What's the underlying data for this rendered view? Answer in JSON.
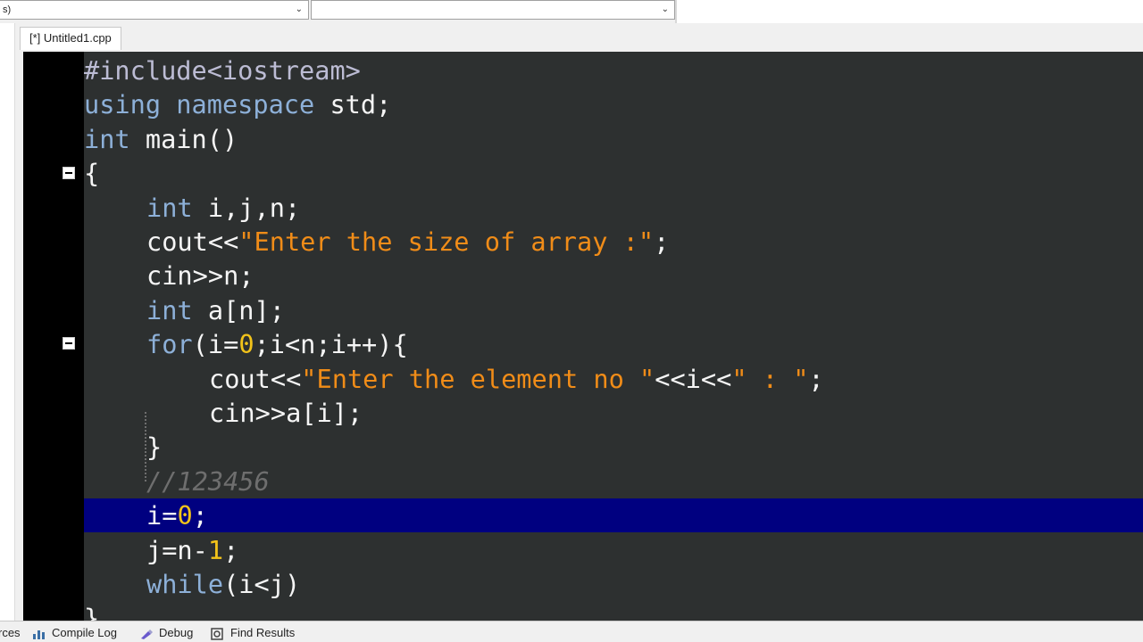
{
  "toolbar": {
    "combo1_value": "s)",
    "combo2_value": ""
  },
  "tabs": [
    {
      "label": "[*] Untitled1.cpp"
    }
  ],
  "editor": {
    "lines": [
      {
        "tokens": [
          {
            "t": "#include<iostream>",
            "c": "pre"
          }
        ]
      },
      {
        "tokens": [
          {
            "t": "using ",
            "c": "kw"
          },
          {
            "t": "namespace ",
            "c": "kw"
          },
          {
            "t": "std;",
            "c": "txt"
          }
        ]
      },
      {
        "tokens": [
          {
            "t": "int ",
            "c": "kw"
          },
          {
            "t": "main()",
            "c": "txt"
          }
        ]
      },
      {
        "tokens": [
          {
            "t": "{",
            "c": "txt"
          }
        ]
      },
      {
        "tokens": [
          {
            "t": "int ",
            "c": "kw"
          },
          {
            "t": "i,j,n;",
            "c": "txt"
          }
        ]
      },
      {
        "tokens": [
          {
            "t": "cout<<",
            "c": "txt"
          },
          {
            "t": "\"Enter the size of array :\"",
            "c": "str"
          },
          {
            "t": ";",
            "c": "txt"
          }
        ]
      },
      {
        "tokens": [
          {
            "t": "cin>>n;",
            "c": "txt"
          }
        ]
      },
      {
        "tokens": [
          {
            "t": "int ",
            "c": "kw"
          },
          {
            "t": "a[n];",
            "c": "txt"
          }
        ]
      },
      {
        "tokens": [
          {
            "t": "for",
            "c": "kw"
          },
          {
            "t": "(i=",
            "c": "txt"
          },
          {
            "t": "0",
            "c": "num"
          },
          {
            "t": ";i<n;i++){",
            "c": "txt"
          }
        ]
      },
      {
        "tokens": [
          {
            "t": "cout<<",
            "c": "txt"
          },
          {
            "t": "\"Enter the element no \"",
            "c": "str"
          },
          {
            "t": "<<i<<",
            "c": "txt"
          },
          {
            "t": "\" : \"",
            "c": "str"
          },
          {
            "t": ";",
            "c": "txt"
          }
        ]
      },
      {
        "tokens": [
          {
            "t": "cin>>a[i];",
            "c": "txt"
          }
        ]
      },
      {
        "tokens": [
          {
            "t": "}",
            "c": "txt"
          }
        ]
      },
      {
        "tokens": [
          {
            "t": "//123456",
            "c": "cmt"
          }
        ]
      },
      {
        "tokens": [
          {
            "t": "i=",
            "c": "txt"
          },
          {
            "t": "0",
            "c": "num"
          },
          {
            "t": ";",
            "c": "txt"
          }
        ]
      },
      {
        "tokens": [
          {
            "t": "j=n-",
            "c": "txt"
          },
          {
            "t": "1",
            "c": "num"
          },
          {
            "t": ";",
            "c": "txt"
          }
        ]
      },
      {
        "tokens": [
          {
            "t": "while",
            "c": "kw"
          },
          {
            "t": "(i<j)",
            "c": "txt"
          }
        ]
      },
      {
        "tokens": [
          {
            "t": "}",
            "c": "txt"
          }
        ]
      }
    ]
  },
  "bottom_tabs": [
    {
      "label": "rces"
    },
    {
      "label": "Compile Log"
    },
    {
      "label": "Debug"
    },
    {
      "label": "Find Results"
    }
  ],
  "colors": {
    "editor_bg": "#2d3030",
    "gutter_bg": "#000000",
    "highlight_line": "#000080",
    "keyword": "#8db0d8",
    "string": "#f08c18",
    "number": "#f2c31a",
    "comment": "#6e6e6e"
  }
}
